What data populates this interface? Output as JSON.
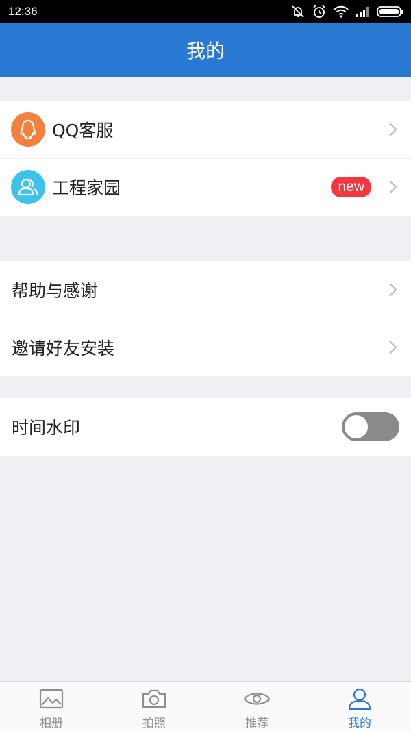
{
  "status_bar": {
    "time": "12:36"
  },
  "header": {
    "title": "我的"
  },
  "groups": {
    "g1": [
      {
        "label": "QQ客服",
        "icon": "qq-penguin-icon",
        "icon_bg": "#f3803e"
      },
      {
        "label": "工程家园",
        "icon": "users-icon",
        "icon_bg": "#3ec2ec",
        "badge": "new"
      }
    ],
    "g2": [
      {
        "label": "帮助与感谢"
      },
      {
        "label": "邀请好友安装"
      }
    ],
    "g3": [
      {
        "label": "时间水印",
        "toggle": false
      }
    ]
  },
  "tabs": [
    {
      "label": "相册",
      "icon": "image-icon"
    },
    {
      "label": "拍照",
      "icon": "camera-icon"
    },
    {
      "label": "推荐",
      "icon": "eye-icon"
    },
    {
      "label": "我的",
      "icon": "user-icon",
      "active": true
    }
  ],
  "colors": {
    "header_bg": "#2979d3",
    "badge_bg": "#f4363e",
    "active_tab": "#2979d3"
  }
}
